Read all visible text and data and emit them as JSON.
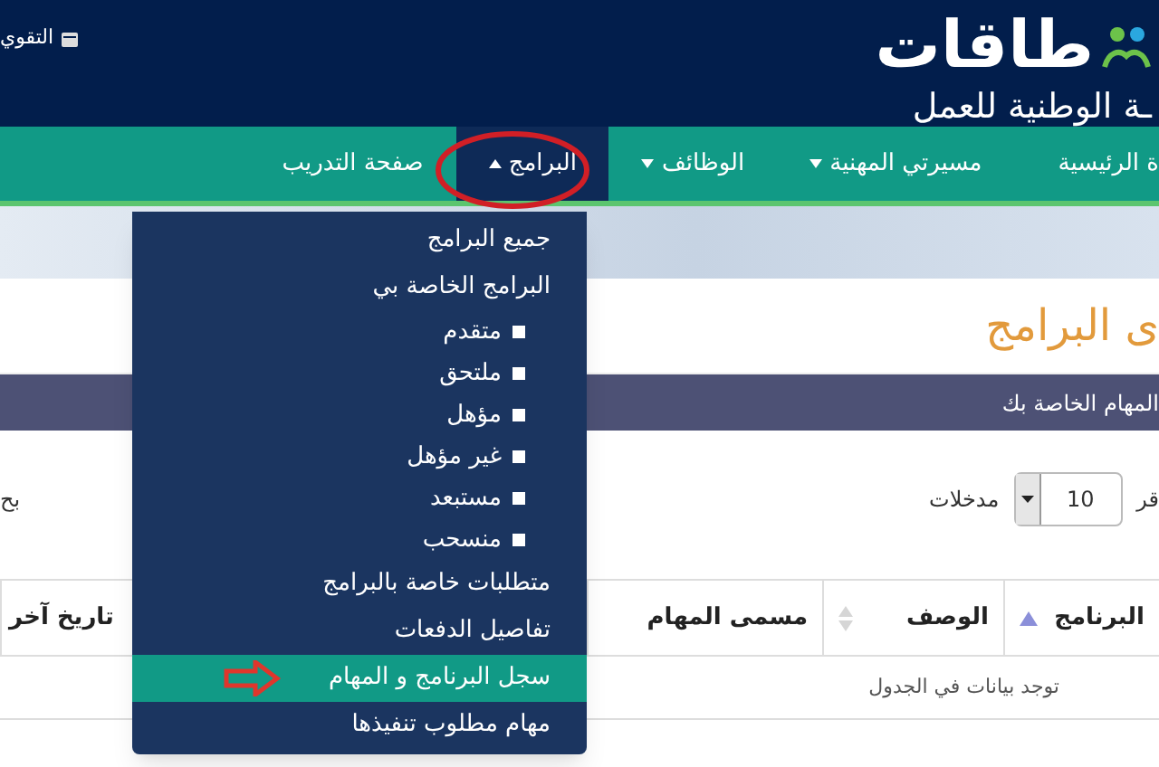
{
  "header": {
    "logo_text": "طاقات",
    "logo_subtitle": "ـة الوطنية للعمل",
    "calendar_link": "التقوي"
  },
  "nav": [
    {
      "label": "ة الرئيسية",
      "has_menu": false,
      "selected": false
    },
    {
      "label": "مسيرتي المهنية",
      "has_menu": true,
      "selected": false
    },
    {
      "label": "الوظائف",
      "has_menu": true,
      "selected": false
    },
    {
      "label": "البرامج",
      "has_menu": true,
      "selected": true
    },
    {
      "label": "صفحة التدريب",
      "has_menu": false,
      "selected": false
    }
  ],
  "dropdown": [
    {
      "label": "جميع البرامج",
      "kind": "link",
      "selected": false
    },
    {
      "label": "البرامج الخاصة بي",
      "kind": "link",
      "selected": false
    },
    {
      "label": "متقدم",
      "kind": "status",
      "selected": false
    },
    {
      "label": "ملتحق",
      "kind": "status",
      "selected": false
    },
    {
      "label": "مؤهل",
      "kind": "status",
      "selected": false
    },
    {
      "label": "غير مؤهل",
      "kind": "status",
      "selected": false
    },
    {
      "label": "مستبعد",
      "kind": "status",
      "selected": false
    },
    {
      "label": "منسحب",
      "kind": "status",
      "selected": false
    },
    {
      "label": "متطلبات خاصة بالبرامج",
      "kind": "link",
      "selected": false
    },
    {
      "label": "تفاصيل الدفعات",
      "kind": "link",
      "selected": false
    },
    {
      "label": "سجل البرنامج و المهام",
      "kind": "link",
      "selected": true
    },
    {
      "label": "مهام مطلوب تنفيذها",
      "kind": "link",
      "selected": false
    }
  ],
  "page_title": "ى البرامج",
  "section_bar": "المهام الخاصة بك",
  "controls": {
    "show_prefix": "قر",
    "page_size": "10",
    "entries_label": "مدخلات",
    "search_label": "بح"
  },
  "table": {
    "columns": [
      {
        "label": "البرنامج",
        "sortable": true,
        "sorted": true
      },
      {
        "label": "الوصف",
        "sortable": true,
        "sorted": false
      },
      {
        "label": "مسمى المهام"
      },
      {
        "label": "تاريخ آخر"
      }
    ],
    "empty_message": "توجد بيانات في الجدول"
  }
}
